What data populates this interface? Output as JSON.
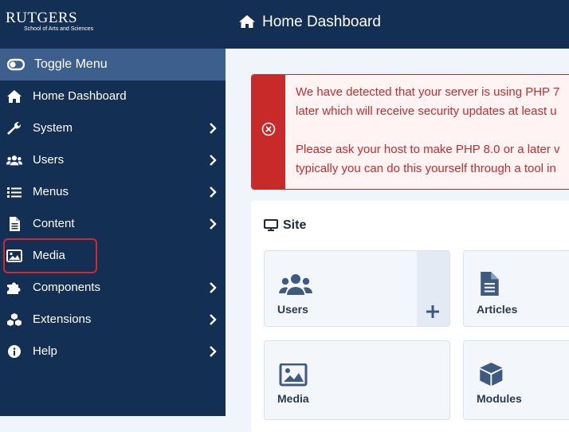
{
  "logo": {
    "name": "RUTGERS",
    "subtitle": "School of Arts and Sciences"
  },
  "sidebar": {
    "toggle_label": "Toggle Menu",
    "items": [
      {
        "label": "Home Dashboard",
        "icon": "home-icon",
        "has_submenu": false
      },
      {
        "label": "System",
        "icon": "wrench-icon",
        "has_submenu": true
      },
      {
        "label": "Users",
        "icon": "users-icon",
        "has_submenu": true
      },
      {
        "label": "Menus",
        "icon": "list-icon",
        "has_submenu": true
      },
      {
        "label": "Content",
        "icon": "file-icon",
        "has_submenu": true
      },
      {
        "label": "Media",
        "icon": "image-icon",
        "has_submenu": false
      },
      {
        "label": "Components",
        "icon": "puzzle-icon",
        "has_submenu": true
      },
      {
        "label": "Extensions",
        "icon": "cubes-icon",
        "has_submenu": true
      },
      {
        "label": "Help",
        "icon": "info-icon",
        "has_submenu": true
      }
    ]
  },
  "header": {
    "title": "Home Dashboard",
    "icon": "home-icon"
  },
  "alert": {
    "lines": [
      "We have detected that your server is using PHP 7",
      "later which will receive security updates at least u",
      "Please ask your host to make PHP 8.0 or a later v",
      "typically you can do this yourself through a tool in"
    ],
    "icon": "close-circle-icon"
  },
  "site": {
    "title": "Site",
    "tiles": [
      {
        "label": "Users",
        "icon": "users-icon",
        "add_icon": "plus-icon"
      },
      {
        "label": "Articles",
        "icon": "file-icon"
      },
      {
        "label": "Media",
        "icon": "image-icon"
      },
      {
        "label": "Modules",
        "icon": "cube-icon"
      }
    ]
  },
  "colors": {
    "sidebar_bg": "#132f53",
    "toggle_bg": "#3d5f8d",
    "alert_red": "#c82a2a",
    "highlight": "#d6262d"
  }
}
